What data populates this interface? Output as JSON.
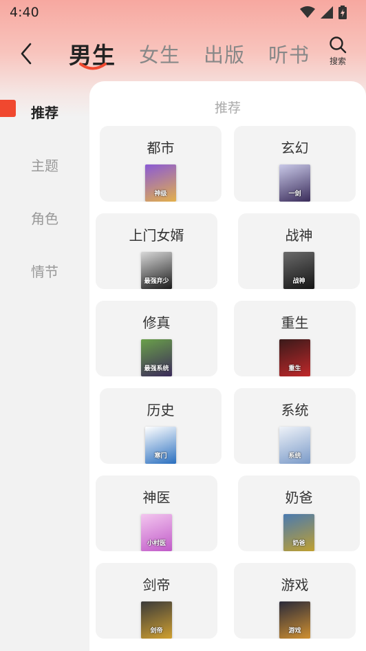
{
  "status": {
    "time": "4:40"
  },
  "nav": {
    "tabs": [
      "男生",
      "女生",
      "出版",
      "听书"
    ],
    "search_label": "搜索"
  },
  "sidebar": {
    "items": [
      "推荐",
      "主题",
      "角色",
      "情节"
    ]
  },
  "section_title": "推荐",
  "categories": [
    {
      "label": "都市",
      "cover_text": "神级",
      "cover_colors": [
        "#8a5ad6",
        "#e3b04b"
      ]
    },
    {
      "label": "玄幻",
      "cover_text": "一剑",
      "cover_colors": [
        "#c9c9e8",
        "#3a2c5a"
      ]
    },
    {
      "label": "上门女婿",
      "cover_text": "最强弃少",
      "cover_colors": [
        "#d8d8d8",
        "#1a1a1a"
      ]
    },
    {
      "label": "战神",
      "cover_text": "战神",
      "cover_colors": [
        "#6a6a6a",
        "#141414"
      ]
    },
    {
      "label": "修真",
      "cover_text": "最强系统",
      "cover_colors": [
        "#6aa04a",
        "#3b2a5a"
      ]
    },
    {
      "label": "重生",
      "cover_text": "重生",
      "cover_colors": [
        "#3a1a1a",
        "#c0282a"
      ]
    },
    {
      "label": "历史",
      "cover_text": "寒门",
      "cover_colors": [
        "#ffffff",
        "#2a6fbf"
      ]
    },
    {
      "label": "系统",
      "cover_text": "系统",
      "cover_colors": [
        "#eef2f8",
        "#7a9ac8"
      ]
    },
    {
      "label": "神医",
      "cover_text": "小村医",
      "cover_colors": [
        "#f3c6ef",
        "#c05ac8"
      ]
    },
    {
      "label": "奶爸",
      "cover_text": "奶爸",
      "cover_colors": [
        "#4a7ab0",
        "#c0a030"
      ]
    },
    {
      "label": "剑帝",
      "cover_text": "剑帝",
      "cover_colors": [
        "#3a3a3a",
        "#d0a030"
      ]
    },
    {
      "label": "游戏",
      "cover_text": "游戏",
      "cover_colors": [
        "#2a2a3a",
        "#d09030"
      ]
    }
  ],
  "colors": {
    "accent": "#f0482f",
    "header_gradient_top": "#f7a8a0"
  },
  "icons": {
    "back": "chevron-left-icon",
    "search": "search-icon",
    "wifi": "wifi-icon",
    "signal": "signal-icon",
    "battery": "battery-icon"
  }
}
